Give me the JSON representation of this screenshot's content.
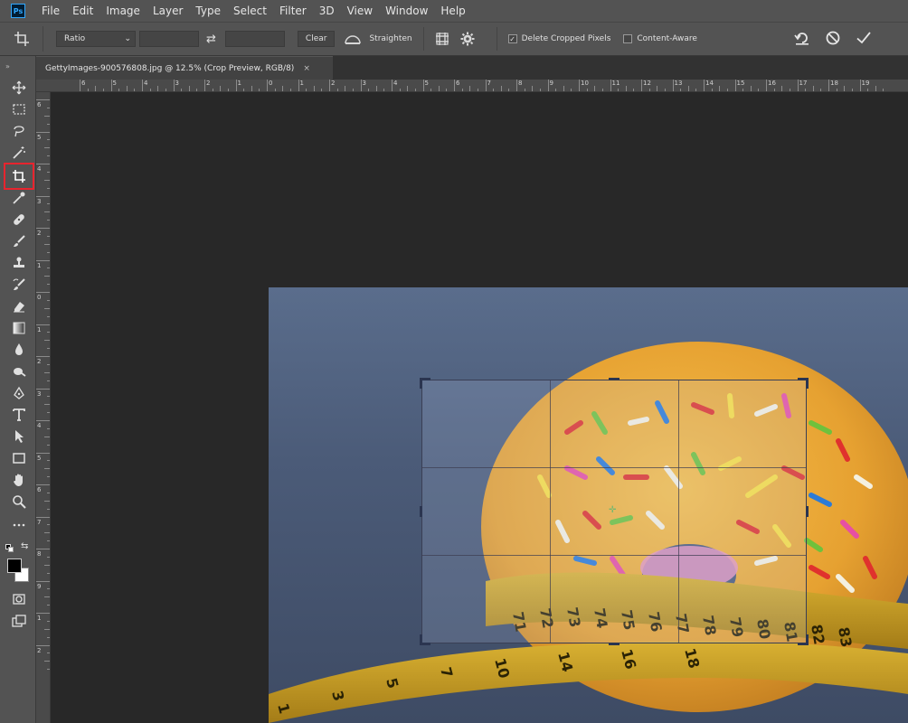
{
  "app": {
    "logo": "Ps"
  },
  "menu": [
    "File",
    "Edit",
    "Image",
    "Layer",
    "Type",
    "Select",
    "Filter",
    "3D",
    "View",
    "Window",
    "Help"
  ],
  "options": {
    "ratio_label": "Ratio",
    "clear_label": "Clear",
    "straighten_label": "Straighten",
    "delete_cropped_label": "Delete Cropped Pixels",
    "delete_cropped_checked": true,
    "content_aware_label": "Content-Aware",
    "content_aware_checked": false
  },
  "document": {
    "tab_title": "GettyImages-900576808.jpg @ 12.5% (Crop Preview, RGB/8)",
    "close_glyph": "×"
  },
  "ruler": {
    "top_numbers": [
      "6",
      "5",
      "4",
      "3",
      "2",
      "1",
      "0",
      "1",
      "2",
      "3",
      "4",
      "5",
      "6",
      "7",
      "8",
      "9",
      "10",
      "11",
      "12",
      "13",
      "14",
      "15",
      "16",
      "17",
      "18",
      "19"
    ],
    "left_numbers": [
      "6",
      "5",
      "4",
      "3",
      "2",
      "1",
      "0",
      "1",
      "2",
      "3",
      "4",
      "5",
      "6",
      "7",
      "8",
      "9",
      "1",
      "2"
    ]
  },
  "tools": [
    {
      "name": "move-tool-icon"
    },
    {
      "name": "marquee-tool-icon"
    },
    {
      "name": "lasso-tool-icon"
    },
    {
      "name": "magic-wand-tool-icon"
    },
    {
      "name": "crop-tool-icon",
      "active": true
    },
    {
      "name": "eyedropper-tool-icon"
    },
    {
      "name": "healing-brush-tool-icon"
    },
    {
      "name": "brush-tool-icon"
    },
    {
      "name": "clone-stamp-tool-icon"
    },
    {
      "name": "history-brush-tool-icon"
    },
    {
      "name": "eraser-tool-icon"
    },
    {
      "name": "gradient-tool-icon"
    },
    {
      "name": "blur-tool-icon"
    },
    {
      "name": "dodge-tool-icon"
    },
    {
      "name": "pen-tool-icon"
    },
    {
      "name": "type-tool-icon"
    },
    {
      "name": "path-selection-tool-icon"
    },
    {
      "name": "rectangle-tool-icon"
    },
    {
      "name": "hand-tool-icon"
    },
    {
      "name": "zoom-tool-icon"
    },
    {
      "name": "more-tools-icon"
    }
  ],
  "colors": {
    "foreground": "#000000",
    "background": "#ffffff",
    "highlight": "#e8242e",
    "panel": "#535353",
    "canvas_bg": "#282828"
  }
}
